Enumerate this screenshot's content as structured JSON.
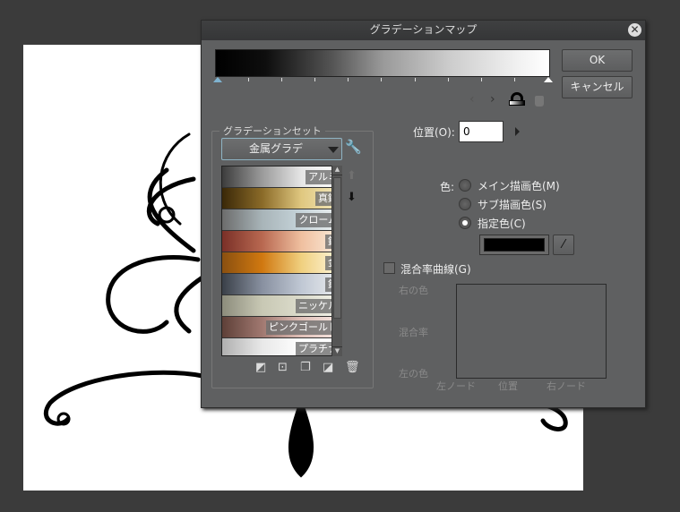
{
  "dialog": {
    "title": "グラデーションマップ",
    "ok": "OK",
    "cancel": "キャンセル"
  },
  "gradient_set": {
    "legend": "グラデーションセット",
    "selected": "金属グラデ",
    "items": [
      {
        "label": "アルミ",
        "colors": [
          "#3c3c3c",
          "#9a9a9a",
          "#e6e6e6",
          "#ffffff"
        ]
      },
      {
        "label": "真鍮",
        "colors": [
          "#3a2808",
          "#8a6a28",
          "#e0c880",
          "#f4eac0"
        ]
      },
      {
        "label": "クローム",
        "colors": [
          "#6c6c6c",
          "#a8b4b8",
          "#c6d4da",
          "#eef0f0"
        ]
      },
      {
        "label": "銅",
        "colors": [
          "#7a3028",
          "#b86850",
          "#f0c0a0",
          "#fbeede"
        ]
      },
      {
        "label": "金",
        "colors": [
          "#8a5010",
          "#d07810",
          "#f0d080",
          "#fff8e0"
        ]
      },
      {
        "label": "鉛",
        "colors": [
          "#3a4048",
          "#8890a0",
          "#c0c8d4",
          "#eceef0"
        ]
      },
      {
        "label": "ニッケル",
        "colors": [
          "#8c8c7c",
          "#c8c8b4",
          "#dcdccc",
          "#f4f4ec"
        ]
      },
      {
        "label": "ピンクゴールド",
        "colors": [
          "#5e4038",
          "#a07870",
          "#e0c0b8",
          "#f8eae4"
        ]
      },
      {
        "label": "プラチナ",
        "colors": [
          "#b0b0b0",
          "#e8e8e8",
          "#ffffff",
          "#ffffff"
        ]
      }
    ]
  },
  "position": {
    "label": "位置(O):",
    "value": "0"
  },
  "color": {
    "label": "色:",
    "options": [
      "メイン描画色(M)",
      "サブ描画色(S)",
      "指定色(C)"
    ],
    "selected": 2,
    "value": "#000000"
  },
  "curve": {
    "checkbox": "混合率曲線(G)",
    "checked": false,
    "y_top": "右の色",
    "y_mid": "混合率",
    "y_bottom": "左の色",
    "x_left": "左ノード",
    "x_mid": "位置",
    "x_right": "右ノード"
  }
}
